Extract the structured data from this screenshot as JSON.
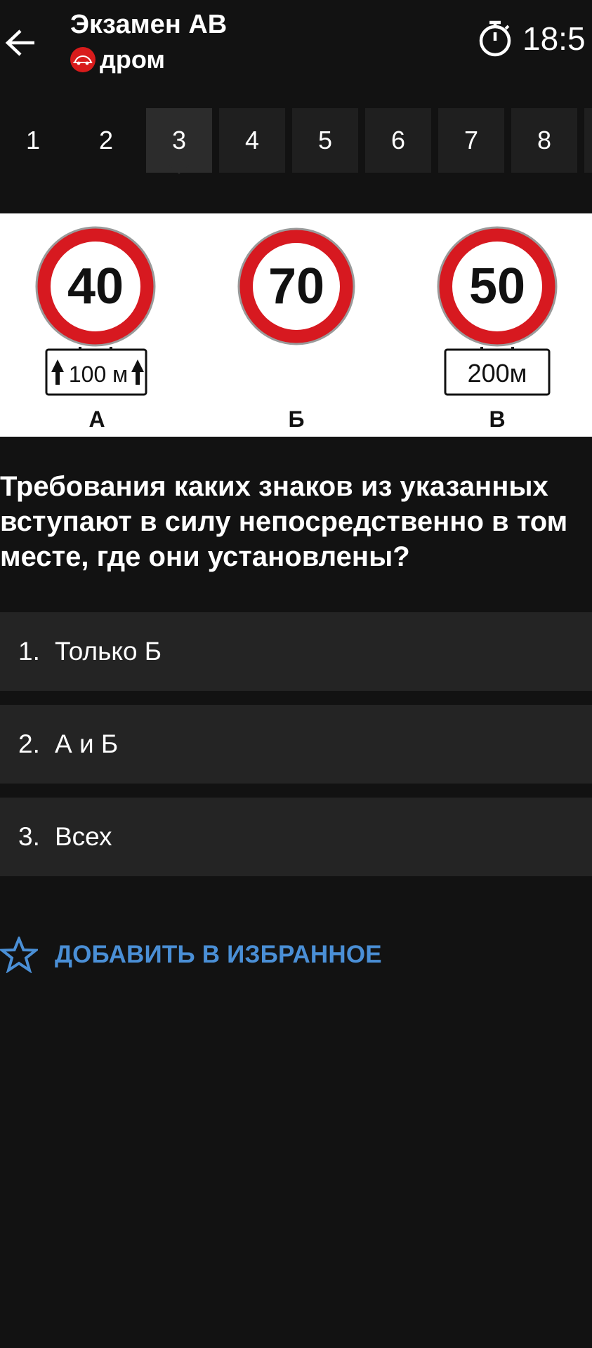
{
  "header": {
    "title": "Экзамен АВ",
    "brand": "дром",
    "timer": "18:5"
  },
  "tabs": [
    {
      "label": "1"
    },
    {
      "label": "2"
    },
    {
      "label": "3"
    },
    {
      "label": "4"
    },
    {
      "label": "5"
    },
    {
      "label": "6"
    },
    {
      "label": "7"
    },
    {
      "label": "8"
    }
  ],
  "active_tab": "3",
  "signs": [
    {
      "speed": "40",
      "plate": "100 м",
      "letter": "А"
    },
    {
      "speed": "70",
      "plate": "",
      "letter": "Б"
    },
    {
      "speed": "50",
      "plate": "200м",
      "letter": "В"
    }
  ],
  "question": {
    "text": "Требования каких знаков из указанных вступают в силу непосредственно в том месте, где они установлены?"
  },
  "answers": [
    {
      "num": "1.",
      "text": "Только Б"
    },
    {
      "num": "2.",
      "text": "А и Б"
    },
    {
      "num": "3.",
      "text": "Всех"
    }
  ],
  "favorite": {
    "label": "ДОБАВИТЬ В ИЗБРАННОЕ"
  },
  "colors": {
    "background": "#121212",
    "tab": "#1f1f1f",
    "tab_active": "#2c2c2c",
    "answer_bg": "#242424",
    "accent": "#4a8fd6",
    "brand_red": "#d81b1b",
    "sign_red": "#d71920"
  },
  "icons": [
    "back-arrow-icon",
    "drom-logo-icon",
    "stopwatch-icon",
    "star-outline-icon"
  ]
}
